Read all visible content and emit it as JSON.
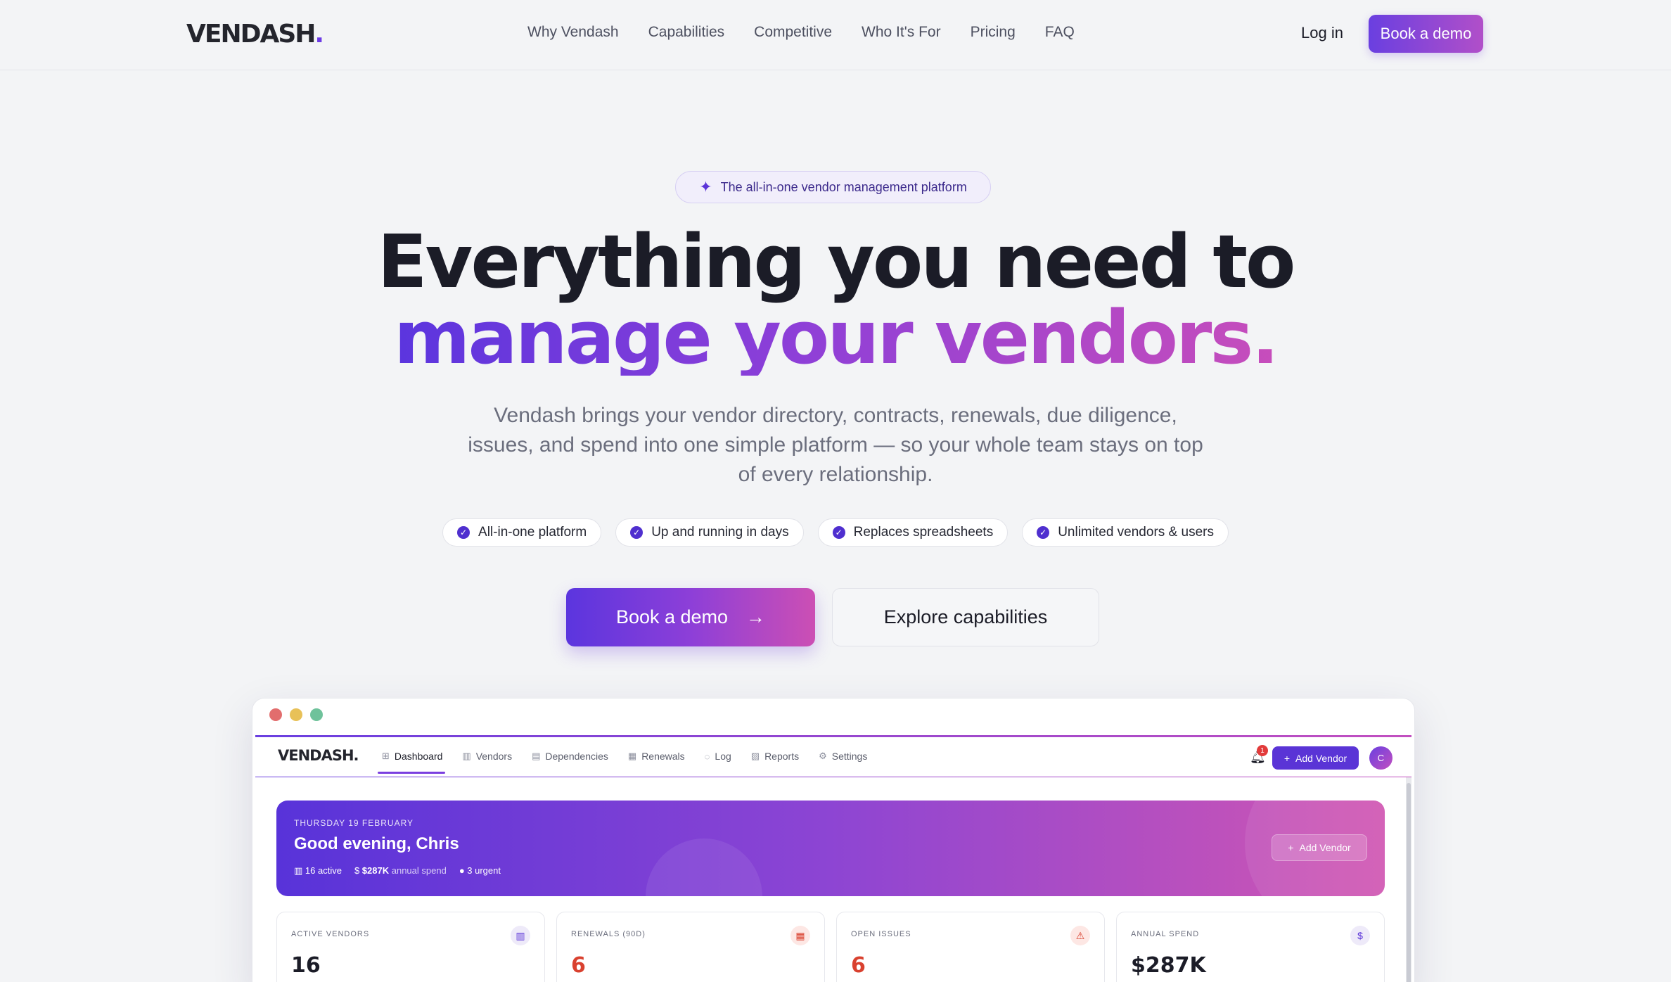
{
  "brand": {
    "logo_main": "VENDASH",
    "logo_dot": "."
  },
  "nav": {
    "links": [
      "Why Vendash",
      "Capabilities",
      "Competitive",
      "Who It's For",
      "Pricing",
      "FAQ"
    ],
    "login": "Log in",
    "cta": "Book a demo"
  },
  "hero": {
    "pill": "The all-in-one vendor management platform",
    "headline_line1": "Everything you need to",
    "headline_line2": "manage your vendors.",
    "subtitle": "Vendash brings your vendor directory, contracts, renewals, due diligence, issues, and spend into one simple platform — so your whole team stays on top of every relationship.",
    "chips": [
      "All-in-one platform",
      "Up and running in days",
      "Replaces spreadsheets",
      "Unlimited vendors & users"
    ],
    "cta_primary": "Book a demo",
    "cta_primary_arrow": "→",
    "cta_secondary": "Explore capabilities"
  },
  "app": {
    "logo": "VENDASH.",
    "tabs": [
      {
        "label": "Dashboard",
        "icon": "grid-icon",
        "glyph": "⊞"
      },
      {
        "label": "Vendors",
        "icon": "building-icon",
        "glyph": "▥"
      },
      {
        "label": "Dependencies",
        "icon": "map-icon",
        "glyph": "▤"
      },
      {
        "label": "Renewals",
        "icon": "calendar-icon",
        "glyph": "▦"
      },
      {
        "label": "Log",
        "icon": "chat-icon",
        "glyph": "◌"
      },
      {
        "label": "Reports",
        "icon": "chart-icon",
        "glyph": "▨"
      },
      {
        "label": "Settings",
        "icon": "gear-icon",
        "glyph": "⚙"
      }
    ],
    "notification_count": "1",
    "add_vendor": "Add Vendor",
    "avatar_initial": "C",
    "banner": {
      "date": "THURSDAY 19 FEBRUARY",
      "greeting": "Good evening, Chris",
      "active": "16 active",
      "spend_value": "$287K",
      "spend_label": "annual spend",
      "urgent": "3 urgent",
      "add_vendor": "Add Vendor"
    },
    "cards": [
      {
        "label": "ACTIVE VENDORS",
        "value": "16",
        "icon": "building-icon",
        "glyph": "▥",
        "value_color": "#1b1c27",
        "icon_bg": "#eeeaf9",
        "icon_color": "#5b34d8"
      },
      {
        "label": "RENEWALS (90D)",
        "value": "6",
        "icon": "calendar-icon",
        "glyph": "▦",
        "value_color": "#d9412f",
        "icon_bg": "#fde7e4",
        "icon_color": "#d9412f"
      },
      {
        "label": "OPEN ISSUES",
        "value": "6",
        "icon": "warning-icon",
        "glyph": "⚠",
        "value_color": "#d9412f",
        "icon_bg": "#fde7e4",
        "icon_color": "#d9412f"
      },
      {
        "label": "ANNUAL SPEND",
        "value": "$287K",
        "icon": "dollar-icon",
        "glyph": "$",
        "value_color": "#1b1c27",
        "icon_bg": "#eeeaf9",
        "icon_color": "#5b34d8"
      }
    ]
  },
  "colors": {
    "accent": "#6a3fe0",
    "accent_pink": "#c74dbb",
    "traffic": [
      "#e26d6d",
      "#e8c158",
      "#6fc29b"
    ]
  }
}
